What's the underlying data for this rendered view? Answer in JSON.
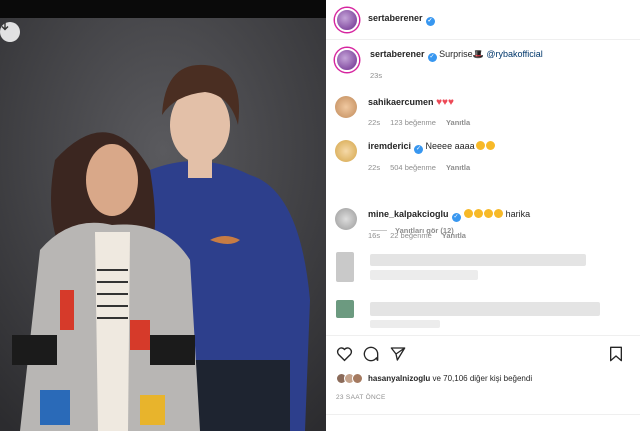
{
  "post": {
    "author": "sertaberener",
    "caption_text": "Surprise",
    "caption_mention": "@rybakofficial",
    "caption_time": "23s"
  },
  "comments": [
    {
      "user": "sahikaercumen",
      "time": "22s",
      "likes": "123 beğenme",
      "reply": "Yanıtla"
    },
    {
      "user": "iremderici",
      "text": "Neeee aaaa",
      "time": "22s",
      "likes": "504 beğenme",
      "reply": "Yanıtla"
    },
    {
      "user": "mine_kalpakcioglu",
      "text": "harika",
      "time": "16s",
      "likes": "22 beğenme",
      "reply": "Yanıtla"
    }
  ],
  "view_replies": "Yanıtları gör (12)",
  "likes_line": {
    "user": "hasanyalnizoglu",
    "rest": "ve 70,106 diğer kişi beğendi"
  },
  "timestamp": "23 SAAT ÖNCE",
  "icons": [
    "download-icon",
    "heart-icon",
    "comment-icon",
    "share-icon",
    "save-icon"
  ],
  "colors": {
    "verified": "#3897f0",
    "heart": "#ed4956",
    "link": "#00376b",
    "meta": "#8e8e8e"
  }
}
